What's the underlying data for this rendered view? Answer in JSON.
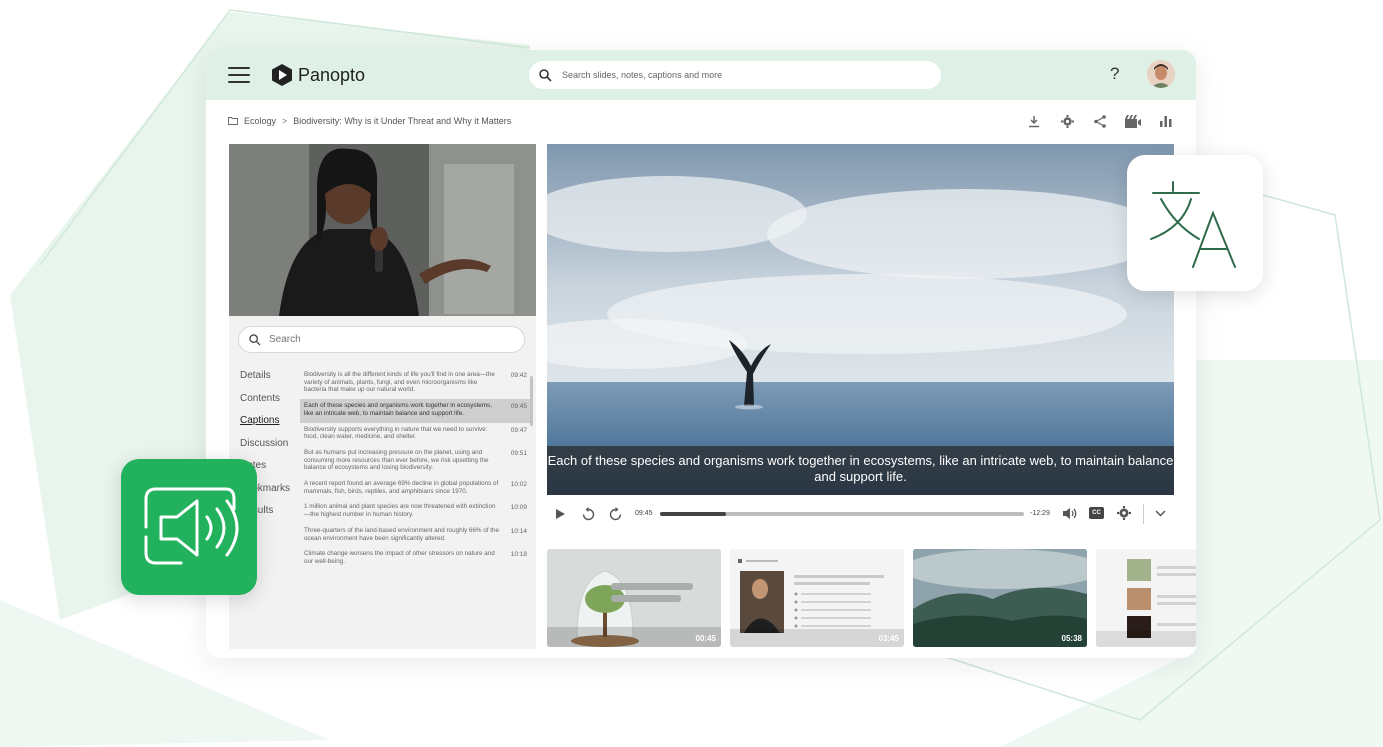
{
  "app": {
    "brand": "Panopto"
  },
  "colors": {
    "accent": "#22b15c",
    "topbar": "#dff0e6",
    "decoration": "#e6f4ec"
  },
  "header": {
    "search_placeholder": "Search slides, notes, captions and more",
    "help_label": "?"
  },
  "breadcrumb": {
    "folder": "Ecology",
    "separator": ">",
    "title": "Biodiversity: Why is it Under Threat and Why it Matters"
  },
  "toolbar": {
    "icons": [
      "download-icon",
      "settings-icon",
      "share-icon",
      "clapper-icon",
      "stats-icon"
    ]
  },
  "sidebar": {
    "search_placeholder": "Search",
    "nav": [
      {
        "label": "Details"
      },
      {
        "label": "Contents"
      },
      {
        "label": "Captions"
      },
      {
        "label": "Discussion"
      },
      {
        "label": "Notes"
      },
      {
        "label": "Bookmarks"
      },
      {
        "label": "Results"
      }
    ],
    "active_nav": "Captions",
    "captions": [
      {
        "text": "Biodiversity is all the different kinds of life you'll find in one area—the variety of animals, plants, fungi, and even microorganisms like bacteria that make up our natural world.",
        "time": "09:42"
      },
      {
        "text": "Each of these species and organisms work together in ecosystems, like an intricate web, to maintain balance and support life.",
        "time": "09:45"
      },
      {
        "text": "Biodiversity supports everything in nature that we need to survive: food, clean water, medicine, and shelter.",
        "time": "09:47"
      },
      {
        "text": "But as humans put increasing pressure on the planet, using and consuming more resources than ever before, we risk upsetting the balance of ecosystems and losing biodiversity.",
        "time": "09:51"
      },
      {
        "text": "A recent report found an average 69% decline in global populations of mammals, fish, birds, reptiles, and amphibians since 1970.",
        "time": "10:02"
      },
      {
        "text": "1 million animal and plant species are now threatened with extinction—the highest number in human history.",
        "time": "10:09"
      },
      {
        "text": "Three-quarters of the land-based environment and roughly 66% of the ocean environment have been significantly altered.",
        "time": "10:14"
      },
      {
        "text": "Climate change worsens the impact of other stressors on nature and our well-being.",
        "time": "10:18"
      }
    ]
  },
  "player": {
    "caption": "Each of these species and organisms work together in ecosystems, like an intricate web, to maintain balance and support life.",
    "current_time": "09:45",
    "remaining_time": "-12:29",
    "progress": 0.18,
    "cc_label": "CC"
  },
  "thumbnails": [
    {
      "duration": "00:45"
    },
    {
      "duration": "03:45"
    },
    {
      "duration": "05:38"
    },
    {
      "duration": ""
    }
  ],
  "overlays": {
    "translate_icon": "translate-icon",
    "audio_icon": "audio-description-icon"
  }
}
